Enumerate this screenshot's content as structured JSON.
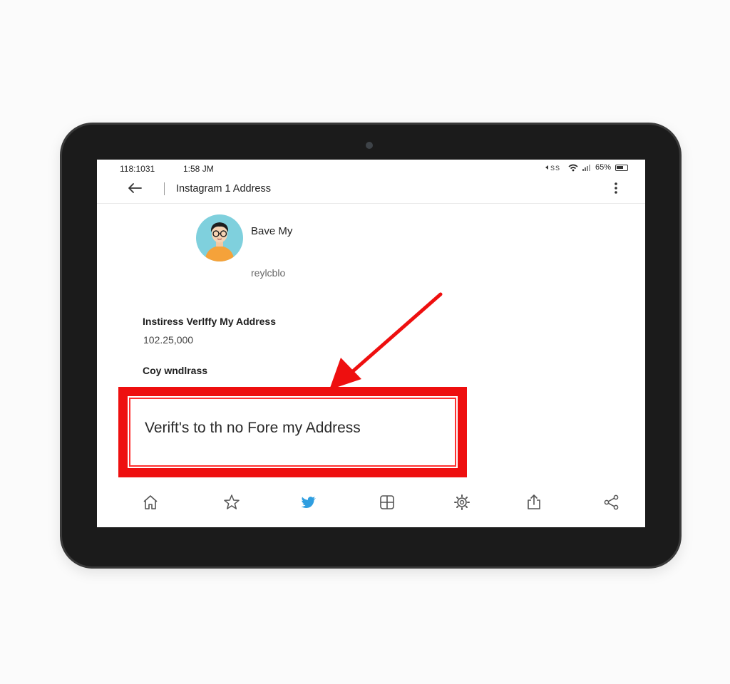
{
  "status_bar": {
    "left_text": "1​18:1031",
    "clock": "1:58 JM",
    "battery_text": "65%"
  },
  "toolbar": {
    "title": "Instagram 1 Address"
  },
  "profile": {
    "name": "Bave My",
    "subtitle": "reylcblo"
  },
  "section": {
    "heading": "Instiress Verlffy My Address",
    "value": "102.25,000",
    "subheading": "Coy wndlrass"
  },
  "highlight": {
    "text": "Verift's to th no Fore my Address"
  },
  "bottom_nav": {
    "items": [
      "home-icon",
      "star-icon",
      "bird-icon",
      "grid-icon",
      "settings-icon",
      "share-up-icon",
      "share-icon"
    ]
  },
  "colors": {
    "highlight": "#ee0f0f",
    "accent_bird": "#2f9ee0",
    "avatar_bg": "#7fd0dd",
    "avatar_shirt": "#f5a23a",
    "bezel": "#1b1b1b"
  }
}
